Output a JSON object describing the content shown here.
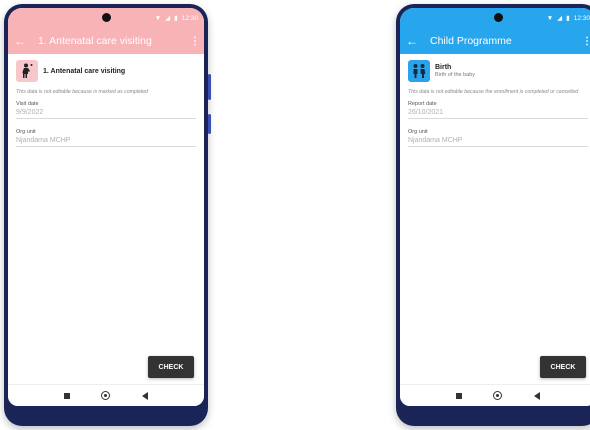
{
  "phones": [
    {
      "status": {
        "time": "12:30"
      },
      "toolbar": {
        "back": "←",
        "title": "1. Antenatal care visiting",
        "more": "⋮"
      },
      "stage": {
        "title": "1. Antenatal care visiting",
        "icon": "pregnant-woman-icon"
      },
      "notice": "This data is not editable because is marked as completed",
      "fields": [
        {
          "label": "Visit date",
          "value": "9/9/2022"
        },
        {
          "label": "Org unit",
          "value": "Njandama MCHP"
        }
      ],
      "check_label": "CHECK",
      "accent": "#f7b3b5"
    },
    {
      "status": {
        "time": "12:30"
      },
      "toolbar": {
        "back": "←",
        "title": "Child Programme",
        "more": "⋮"
      },
      "stage": {
        "title": "Birth",
        "subtitle": "Birth of the baby",
        "icon": "children-icon"
      },
      "notice": "This data is not editable because the enrollment is completed or cancelled",
      "fields": [
        {
          "label": "Report date",
          "value": "26/10/2021"
        },
        {
          "label": "Org unit",
          "value": "Njandama MCHP"
        }
      ],
      "check_label": "CHECK",
      "accent": "#27a6ee"
    }
  ]
}
